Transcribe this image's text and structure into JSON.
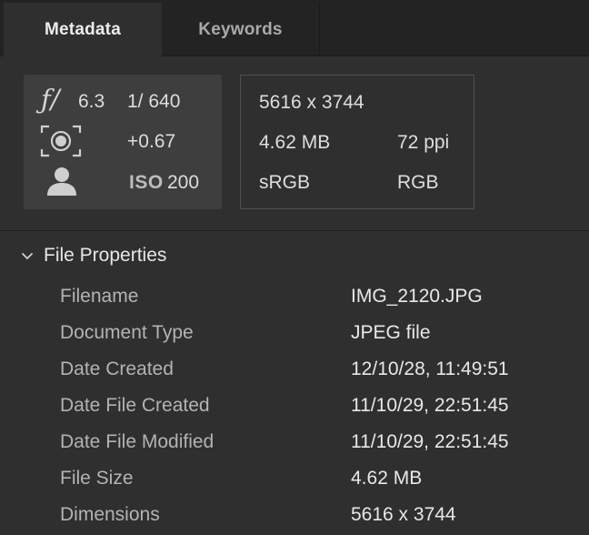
{
  "tabs": [
    {
      "label": "Metadata",
      "active": true
    },
    {
      "label": "Keywords",
      "active": false
    }
  ],
  "exposure": {
    "aperture": "6.3",
    "shutter": "1/ 640",
    "exposure_comp": "+0.67",
    "iso_label": "ISO",
    "iso": "200",
    "icons": [
      "aperture-f-icon",
      "metering-mode-icon",
      "portrait-person-icon"
    ]
  },
  "image_info": {
    "dimensions": "5616 x 3744",
    "size": "4.62 MB",
    "resolution": "72 ppi",
    "color_profile": "sRGB",
    "color_mode": "RGB"
  },
  "file_properties": {
    "title": "File Properties",
    "expanded": true,
    "rows": [
      {
        "key": "Filename",
        "value": "IMG_2120.JPG"
      },
      {
        "key": "Document Type",
        "value": "JPEG file"
      },
      {
        "key": "Date Created",
        "value": "12/10/28, 11:49:51"
      },
      {
        "key": "Date File Created",
        "value": "11/10/29, 22:51:45"
      },
      {
        "key": "Date File Modified",
        "value": "11/10/29, 22:51:45"
      },
      {
        "key": "File Size",
        "value": "4.62 MB"
      },
      {
        "key": "Dimensions",
        "value": "5616 x 3744"
      }
    ]
  },
  "colors": {
    "panel_bg": "#2f2f2f",
    "tabbar_bg": "#232323",
    "exposure_bg": "#3e3e3e"
  }
}
